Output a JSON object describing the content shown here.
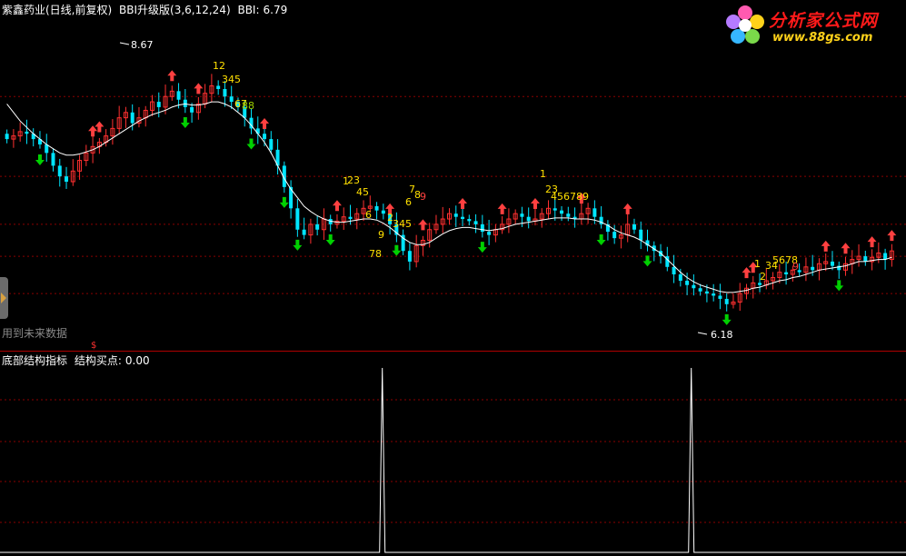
{
  "header": {
    "stock_name": "紫鑫药业(日线,前复权)",
    "indicator": "BBI升级版(3,6,12,24)",
    "bbi_label": "BBI:",
    "bbi_value": "6.79"
  },
  "sub_header": {
    "indicator": "底部结构指标",
    "label": "结构买点:",
    "value": "0.00"
  },
  "logo": {
    "brand": "分析家公式网",
    "site": "www.88gs.com"
  },
  "future_note": "用到未来数据",
  "marker_symbol": "$",
  "colors": {
    "up": "#ff3030",
    "down": "#00e5ff",
    "bbi": "#ffffff",
    "buy_arrow": "#ff4040",
    "sell_arrow": "#00d000",
    "count_yellow": "#ffe000",
    "count_red": "#ff4040",
    "grid": "#8b0000",
    "spike": "#ffffff"
  },
  "chart_data": [
    {
      "type": "candlestick",
      "title": "",
      "y_min": 6.0,
      "y_max": 8.9,
      "gridlines": [
        8.25,
        7.5,
        7.05,
        6.75,
        6.4
      ],
      "annotations": {
        "high": "8.67",
        "low": "6.18"
      },
      "close": [
        7.85,
        7.88,
        7.92,
        7.9,
        7.85,
        7.8,
        7.72,
        7.6,
        7.5,
        7.45,
        7.55,
        7.65,
        7.72,
        7.78,
        7.82,
        7.88,
        7.95,
        8.05,
        8.1,
        8.0,
        8.05,
        8.12,
        8.2,
        8.15,
        8.25,
        8.3,
        8.22,
        8.15,
        8.1,
        8.18,
        8.28,
        8.35,
        8.32,
        8.25,
        8.2,
        8.15,
        8.05,
        7.95,
        7.9,
        7.85,
        7.75,
        7.6,
        7.4,
        7.2,
        7.0,
        6.95,
        7.05,
        7.0,
        7.1,
        7.05,
        7.08,
        7.12,
        7.1,
        7.15,
        7.2,
        7.22,
        7.18,
        7.15,
        7.05,
        6.95,
        6.8,
        6.7,
        6.85,
        6.9,
        7.0,
        7.05,
        7.1,
        7.15,
        7.12,
        7.1,
        7.08,
        7.05,
        6.98,
        6.95,
        7.0,
        7.05,
        7.1,
        7.15,
        7.12,
        7.08,
        7.1,
        7.15,
        7.2,
        7.18,
        7.15,
        7.12,
        7.1,
        7.15,
        7.2,
        7.12,
        7.05,
        6.98,
        6.92,
        6.95,
        7.05,
        7.0,
        6.9,
        6.85,
        6.8,
        6.75,
        6.65,
        6.58,
        6.52,
        6.48,
        6.45,
        6.42,
        6.4,
        6.38,
        6.35,
        6.3,
        6.32,
        6.4,
        6.45,
        6.5,
        6.48,
        6.52,
        6.55,
        6.6,
        6.58,
        6.62,
        6.6,
        6.65,
        6.62,
        6.68,
        6.7,
        6.66,
        6.62,
        6.68,
        6.72,
        6.75,
        6.7,
        6.74,
        6.78,
        6.72,
        6.8
      ],
      "bbi": [
        8.18,
        8.1,
        8.02,
        7.96,
        7.9,
        7.85,
        7.8,
        7.76,
        7.72,
        7.7,
        7.7,
        7.71,
        7.73,
        7.75,
        7.78,
        7.82,
        7.86,
        7.9,
        7.94,
        7.98,
        8.02,
        8.05,
        8.08,
        8.1,
        8.12,
        8.15,
        8.17,
        8.18,
        8.17,
        8.17,
        8.18,
        8.2,
        8.2,
        8.18,
        8.15,
        8.1,
        8.05,
        7.98,
        7.9,
        7.82,
        7.72,
        7.6,
        7.48,
        7.38,
        7.3,
        7.22,
        7.17,
        7.13,
        7.1,
        7.08,
        7.07,
        7.07,
        7.08,
        7.09,
        7.1,
        7.1,
        7.09,
        7.06,
        7.02,
        6.97,
        6.92,
        6.88,
        6.86,
        6.86,
        6.88,
        6.92,
        6.96,
        6.99,
        7.01,
        7.02,
        7.02,
        7.01,
        7.0,
        6.99,
        7.0,
        7.01,
        7.03,
        7.05,
        7.06,
        7.07,
        7.08,
        7.09,
        7.1,
        7.11,
        7.11,
        7.11,
        7.1,
        7.1,
        7.1,
        7.09,
        7.07,
        7.04,
        7.0,
        6.97,
        6.95,
        6.93,
        6.9,
        6.86,
        6.82,
        6.78,
        6.72,
        6.66,
        6.6,
        6.55,
        6.51,
        6.48,
        6.46,
        6.44,
        6.42,
        6.41,
        6.41,
        6.42,
        6.43,
        6.45,
        6.46,
        6.48,
        6.5,
        6.52,
        6.53,
        6.55,
        6.56,
        6.58,
        6.6,
        6.62,
        6.63,
        6.64,
        6.65,
        6.66,
        6.68,
        6.7,
        6.7,
        6.71,
        6.72,
        6.72,
        6.74
      ]
    },
    {
      "type": "line",
      "title": "底部结构指标",
      "y_min": 0,
      "y_max": 1,
      "spikes_at_fraction_of_width": [
        0.422,
        0.763
      ]
    }
  ],
  "counts_text": [
    {
      "text": "12",
      "c": "y"
    },
    {
      "text": "345",
      "c": "y"
    },
    {
      "text": "67",
      "c": "y"
    },
    {
      "text": "88",
      "c": "g"
    },
    {
      "text": "1",
      "c": "y"
    },
    {
      "text": "23",
      "c": "y"
    },
    {
      "text": "45",
      "c": "y"
    },
    {
      "text": "6",
      "c": "y"
    },
    {
      "text": "78",
      "c": "y"
    },
    {
      "text": "9",
      "c": "y"
    },
    {
      "text": "2",
      "c": "y"
    },
    {
      "text": "345",
      "c": "y"
    },
    {
      "text": "6",
      "c": "y"
    },
    {
      "text": "7",
      "c": "y"
    },
    {
      "text": "8",
      "c": "y"
    },
    {
      "text": "9",
      "c": "r"
    },
    {
      "text": "1",
      "c": "y"
    },
    {
      "text": "23",
      "c": "y"
    },
    {
      "text": "456789",
      "c": "y"
    },
    {
      "text": "1",
      "c": "y"
    },
    {
      "text": "2",
      "c": "y"
    },
    {
      "text": "34",
      "c": "y"
    },
    {
      "text": "5678",
      "c": "y"
    },
    {
      "text": "9",
      "c": "r"
    }
  ]
}
